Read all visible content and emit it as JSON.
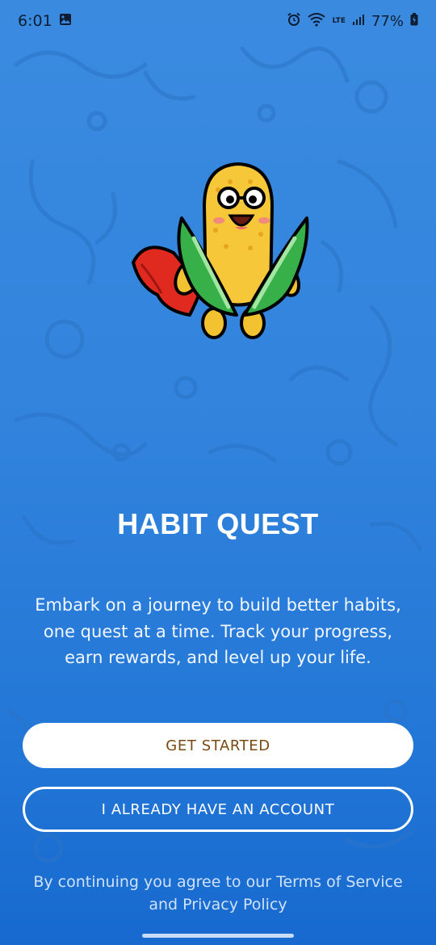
{
  "status_bar": {
    "time": "6:01",
    "lte_label": "LTE",
    "battery_percent": "77%"
  },
  "app": {
    "title": "HABIT QUEST",
    "tagline": "Embark on a journey to build better habits, one quest at a time. Track your progress, earn rewards, and level up your life.",
    "primary_button_label": "GET STARTED",
    "secondary_button_label": "I ALREADY HAVE AN ACCOUNT",
    "legal_text": "By continuing you agree to our Terms of Service and Privacy Policy"
  },
  "icons": {
    "gallery": "gallery-icon",
    "alarm": "alarm-icon",
    "wifi": "wifi-icon",
    "signal": "signal-icon",
    "battery": "battery-icon",
    "mascot": "corn-hero-mascot"
  },
  "colors": {
    "background_top": "#3a8be0",
    "background_bottom": "#1769cf",
    "primary_button_bg": "#ffffff",
    "primary_button_text": "#7a4a12",
    "text": "#ffffff"
  }
}
